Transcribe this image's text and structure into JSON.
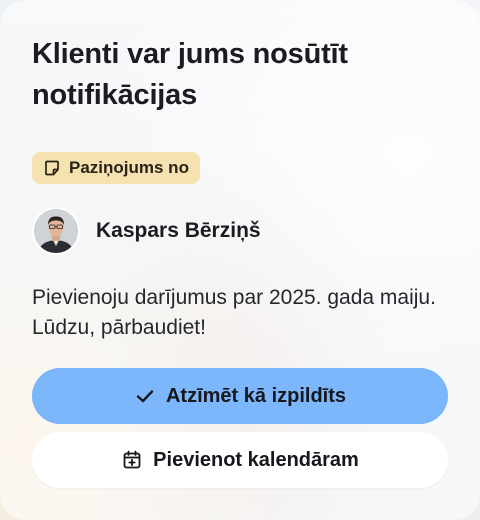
{
  "notification": {
    "title": "Klienti var jums nosūtīt notifikācijas",
    "badge": {
      "icon": "note-icon",
      "label": "Paziņojums no"
    },
    "sender": {
      "name": "Kaspars Bērziņš",
      "avatar": "person-avatar"
    },
    "message": "Pievienoju darījumus par 2025. gada maiju. Lūdzu, pārbaudiet!",
    "actions": {
      "primary": {
        "icon": "checkmark-icon",
        "label": "Atzīmēt kā izpildīts"
      },
      "secondary": {
        "icon": "calendar-plus-icon",
        "label": "Pievienot kalendāram"
      }
    }
  },
  "colors": {
    "badge_bg": "#f6e1b1",
    "primary_button": "#7cb6fb",
    "secondary_button": "#ffffff",
    "text": "#1b1c22"
  }
}
